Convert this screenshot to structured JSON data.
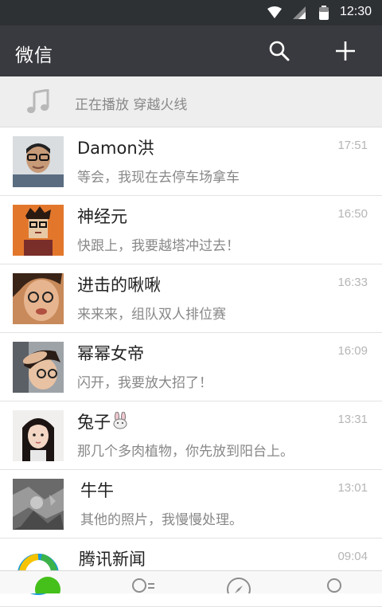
{
  "status_bar": {
    "time": "12:30"
  },
  "header": {
    "title": "微信"
  },
  "now_playing": {
    "text": "正在播放  穿越火线"
  },
  "chats": [
    {
      "name": "Damon洪",
      "preview": "等会，我现在去停车场拿车",
      "time": "17:51"
    },
    {
      "name": "神经元",
      "preview": "快跟上，我要越塔冲过去！",
      "time": "16:50"
    },
    {
      "name": "进击的啾啾",
      "preview": "来来来，组队双人排位赛",
      "time": "16:33"
    },
    {
      "name": "幂幂女帝",
      "preview": "闪开，我要放大招了！",
      "time": "16:09"
    },
    {
      "name": "兔子",
      "preview": "那几个多肉植物，你先放到阳台上。",
      "time": "13:31"
    },
    {
      "name": "牛牛",
      "preview": "其他的照片，我慢慢处理。",
      "time": "13:01"
    },
    {
      "name": "腾讯新闻",
      "preview": "",
      "time": "09:04"
    }
  ],
  "colors": {
    "header_bg": "#393a3f",
    "status_bg": "#2e3134",
    "accent_green": "#45c01a"
  }
}
